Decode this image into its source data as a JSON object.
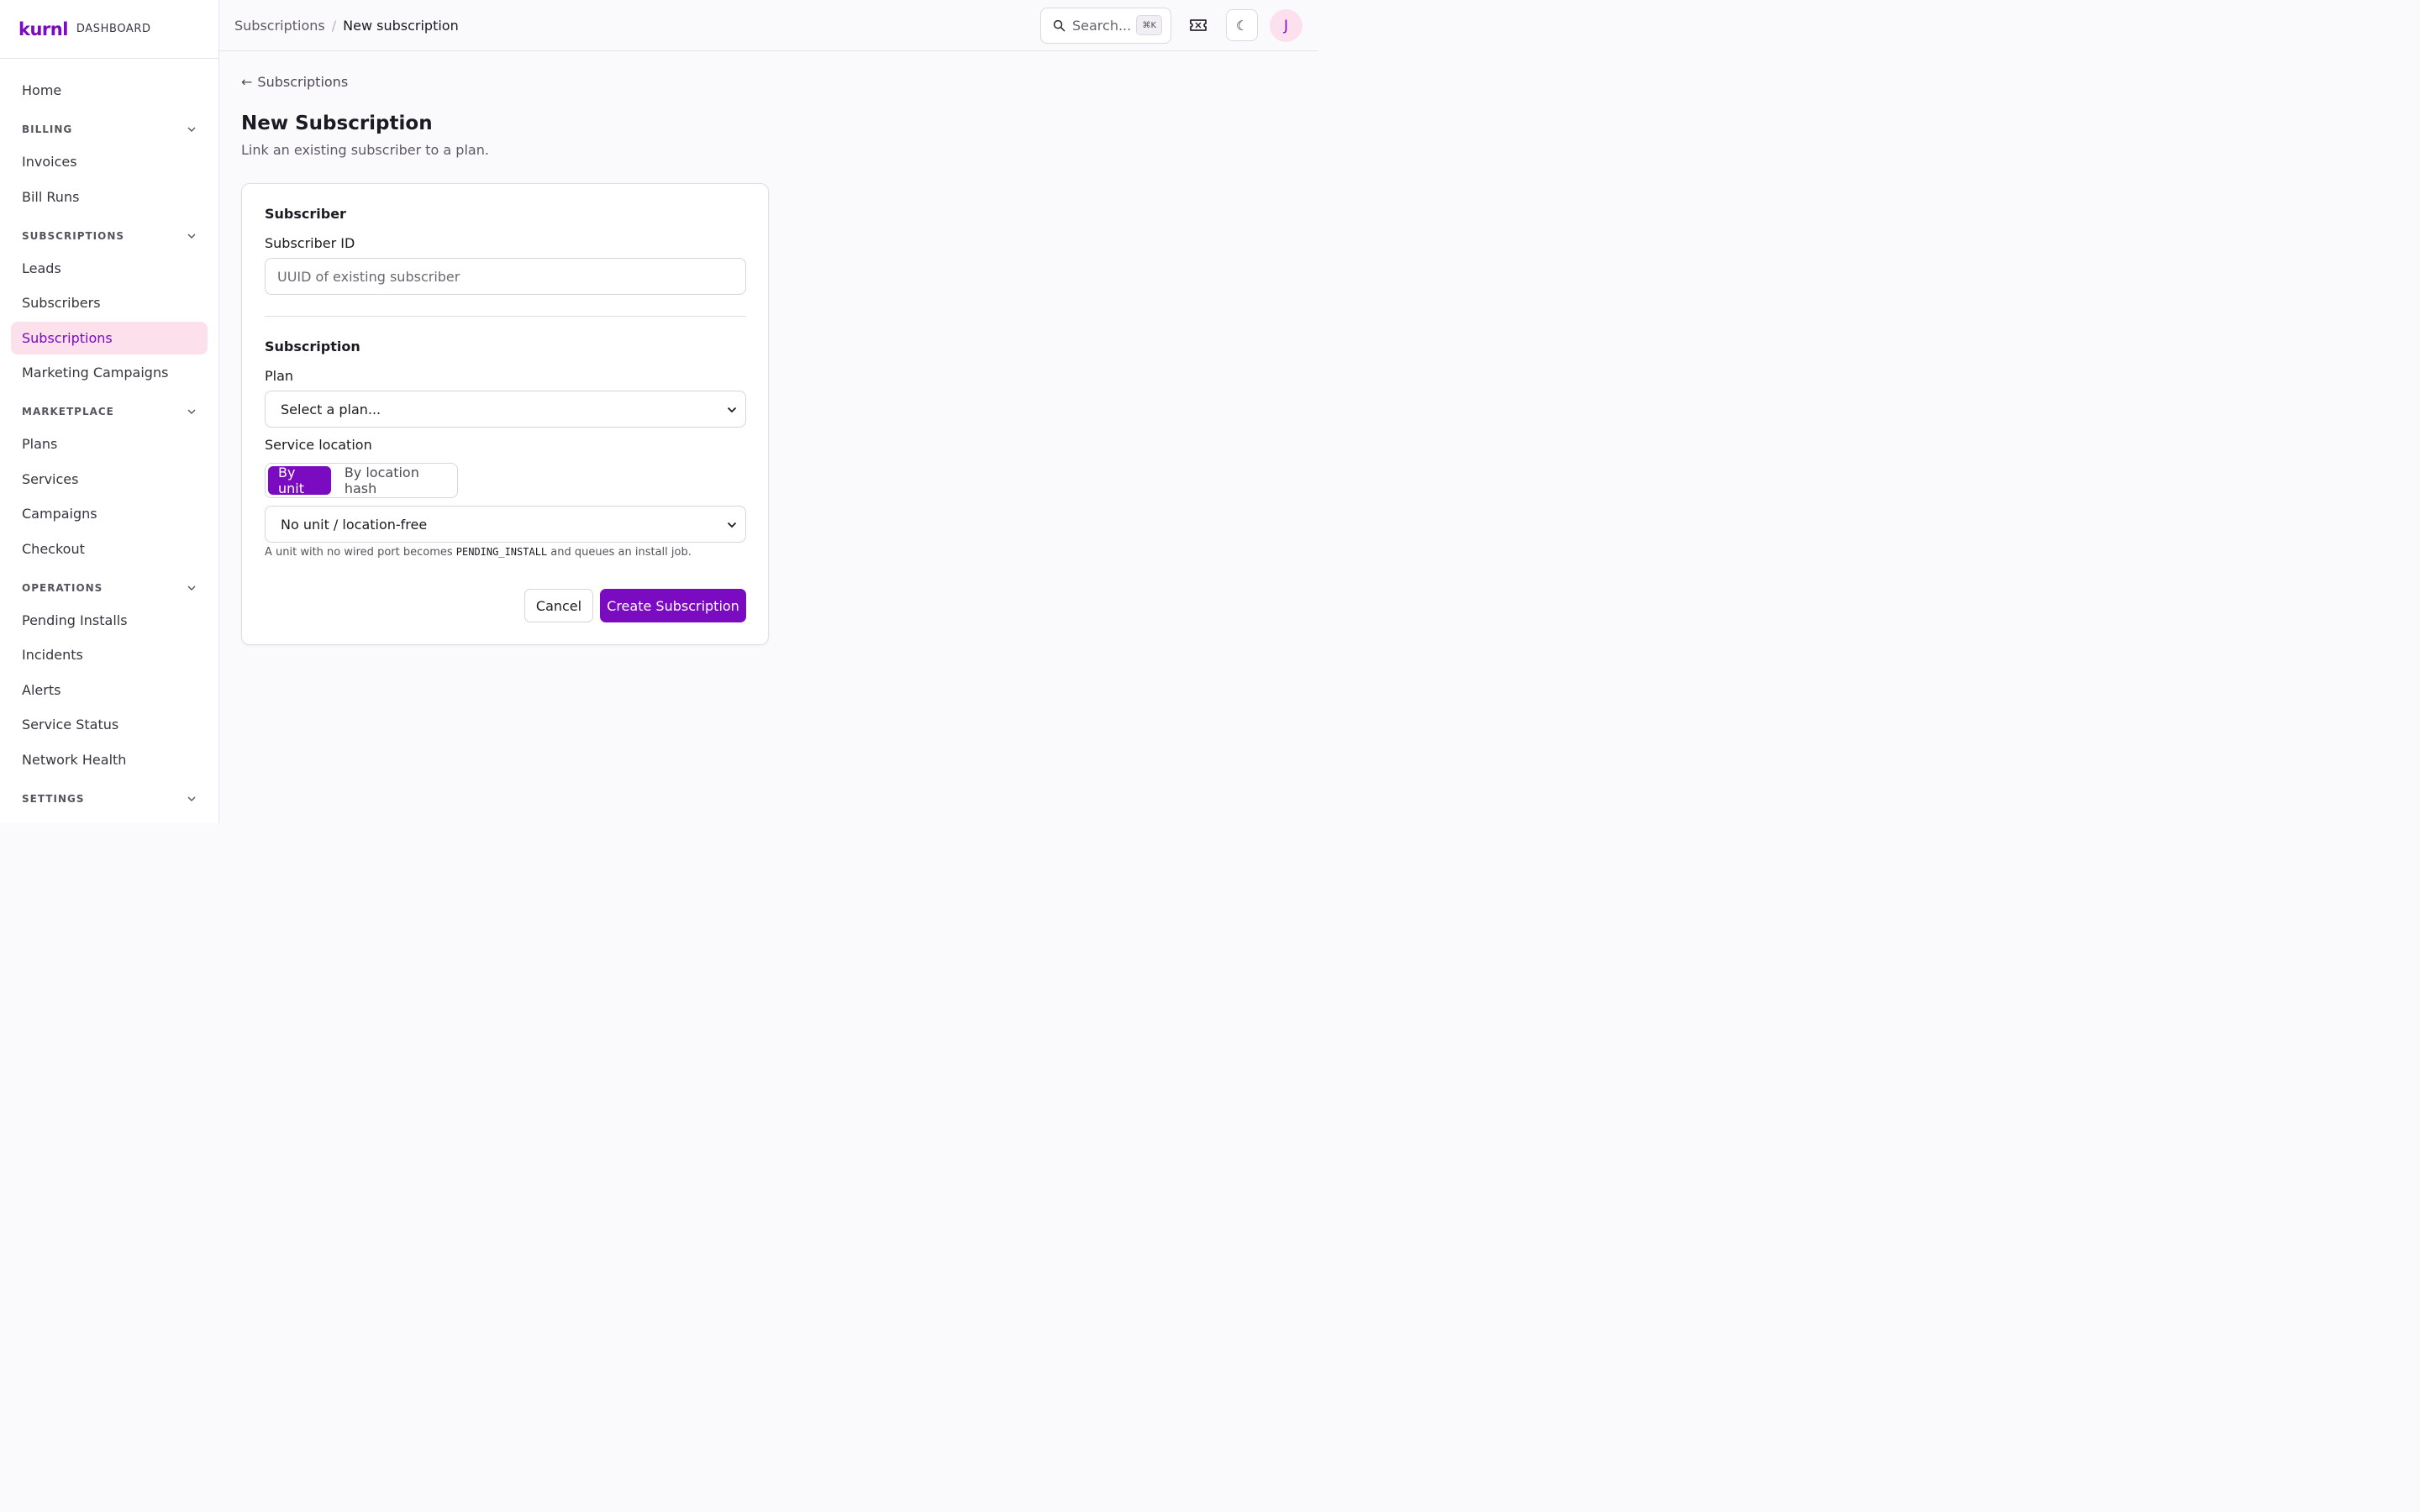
{
  "brand": {
    "logo": "kurnl",
    "tag": "DASHBOARD"
  },
  "sidebar": {
    "home": "Home",
    "sections": [
      {
        "label": "BILLING",
        "items": [
          "Invoices",
          "Bill Runs"
        ]
      },
      {
        "label": "SUBSCRIPTIONS",
        "items": [
          "Leads",
          "Subscribers",
          "Subscriptions",
          "Marketing Campaigns"
        ]
      },
      {
        "label": "MARKETPLACE",
        "items": [
          "Plans",
          "Services",
          "Campaigns",
          "Checkout"
        ]
      },
      {
        "label": "OPERATIONS",
        "items": [
          "Pending Installs",
          "Incidents",
          "Alerts",
          "Service Status",
          "Network Health"
        ]
      },
      {
        "label": "SETTINGS",
        "items": []
      }
    ],
    "active_item": "Subscriptions"
  },
  "topbar": {
    "breadcrumb_parent": "Subscriptions",
    "breadcrumb_sep": "/",
    "breadcrumb_current": "New subscription",
    "search_placeholder": "Search...",
    "search_shortcut": "⌘K",
    "theme_icon": "☾",
    "avatar_initial": "J"
  },
  "page": {
    "back_arrow": "←",
    "back_label": "Subscriptions",
    "title": "New Subscription",
    "subtitle": "Link an existing subscriber to a plan."
  },
  "form": {
    "subscriber_section": "Subscriber",
    "subscriber_id_label": "Subscriber ID",
    "subscriber_id_placeholder": "UUID of existing subscriber",
    "subscriber_id_value": "",
    "subscription_section": "Subscription",
    "plan_label": "Plan",
    "plan_value": "Select a plan...",
    "location_label": "Service location",
    "location_modes": [
      "By unit",
      "By location hash"
    ],
    "location_mode_active": "By unit",
    "unit_value": "No unit / location-free",
    "help_prefix": "A unit with no wired port becomes",
    "help_code": "PENDING_INSTALL",
    "help_suffix": "and queues an install job.",
    "cancel_label": "Cancel",
    "create_label": "Create Subscription"
  },
  "colors": {
    "accent": "#7a0bc0",
    "active_bg": "#fce1ec",
    "avatar_bg": "#fde0ee"
  }
}
